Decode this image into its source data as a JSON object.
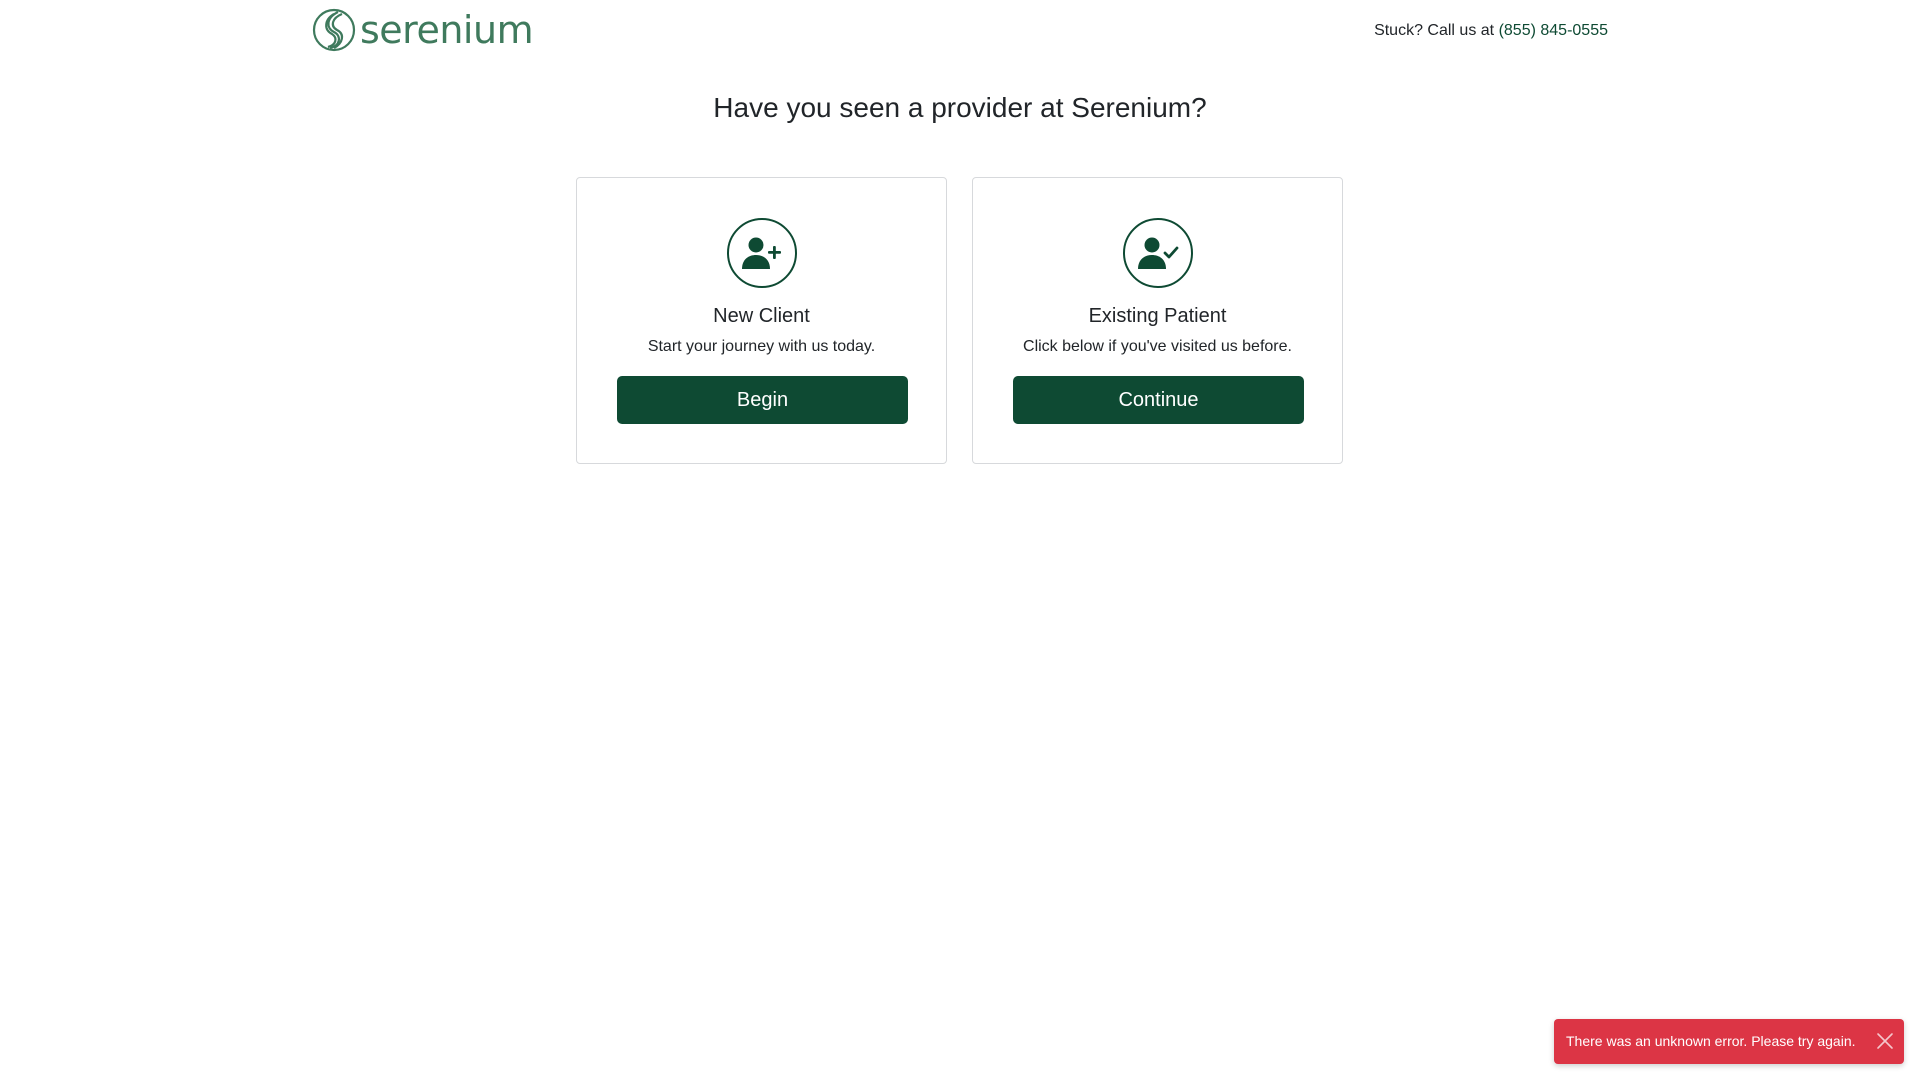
{
  "header": {
    "logo_text": "serenium",
    "help_prefix": "Stuck? Call us at",
    "help_phone": "(855) 845-0555"
  },
  "main": {
    "title": "Have you seen a provider at Serenium?",
    "cards": [
      {
        "icon": "user-plus-icon",
        "title": "New Client",
        "subtitle": "Start your journey with us today.",
        "button_label": "Begin"
      },
      {
        "icon": "user-check-icon",
        "title": "Existing Patient",
        "subtitle": "Click below if you've visited us before.",
        "button_label": "Continue"
      }
    ]
  },
  "toast": {
    "message": "There was an unknown error. Please try again.",
    "close_icon": "close-icon",
    "color": "#dc3545"
  },
  "colors": {
    "brand": "#0e4a33",
    "logo": "#3f7a5d"
  }
}
